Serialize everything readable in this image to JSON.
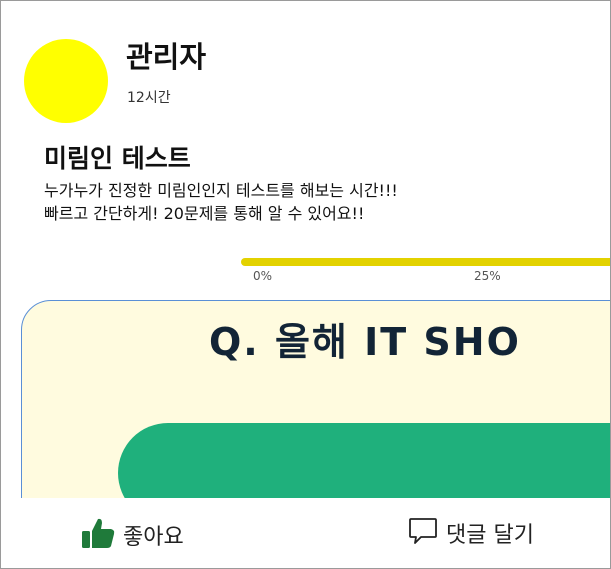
{
  "post": {
    "author": "관리자",
    "time": "12시간",
    "title": "미림인 테스트",
    "body_line1": "누가누가 진정한 미림인인지 테스트를 해보는 시간!!!",
    "body_line2": "빠르고 간단하게! 20문제를 통해 알 수 있어요!!"
  },
  "preview": {
    "progress_labels": [
      "0%",
      "25%"
    ],
    "question": "Q. 올해 IT SHO"
  },
  "actions": {
    "like_label": "좋아요",
    "comment_label": "댓글 달기"
  },
  "icons": {
    "like": "thumbs-up-icon",
    "comment": "speech-bubble-icon"
  },
  "colors": {
    "avatar": "#ffff00",
    "like_icon": "#1f7a3a",
    "progress": "#e3d200",
    "panel_bg": "#fffbdf",
    "panel_border": "#5a8fd6",
    "answer_button": "#1fb07c"
  }
}
